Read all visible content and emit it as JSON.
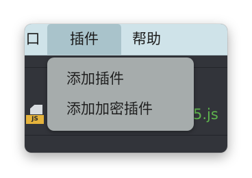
{
  "menubar": {
    "window_label": "口",
    "plugins_label": "插件",
    "help_label": "帮助"
  },
  "file": {
    "icon_badge": "JS",
    "name_suffix": "5.js"
  },
  "dropdown": {
    "items": [
      {
        "label": "添加插件"
      },
      {
        "label": "添加加密插件"
      }
    ]
  },
  "colors": {
    "menubar_bg": "#cfe3e9",
    "menu_active_bg": "#a9c3cb",
    "dropdown_bg": "#a6acac",
    "editor_bg": "#32343a",
    "file_ext_green": "#5fb44e",
    "js_badge_yellow": "#e5b33c"
  }
}
